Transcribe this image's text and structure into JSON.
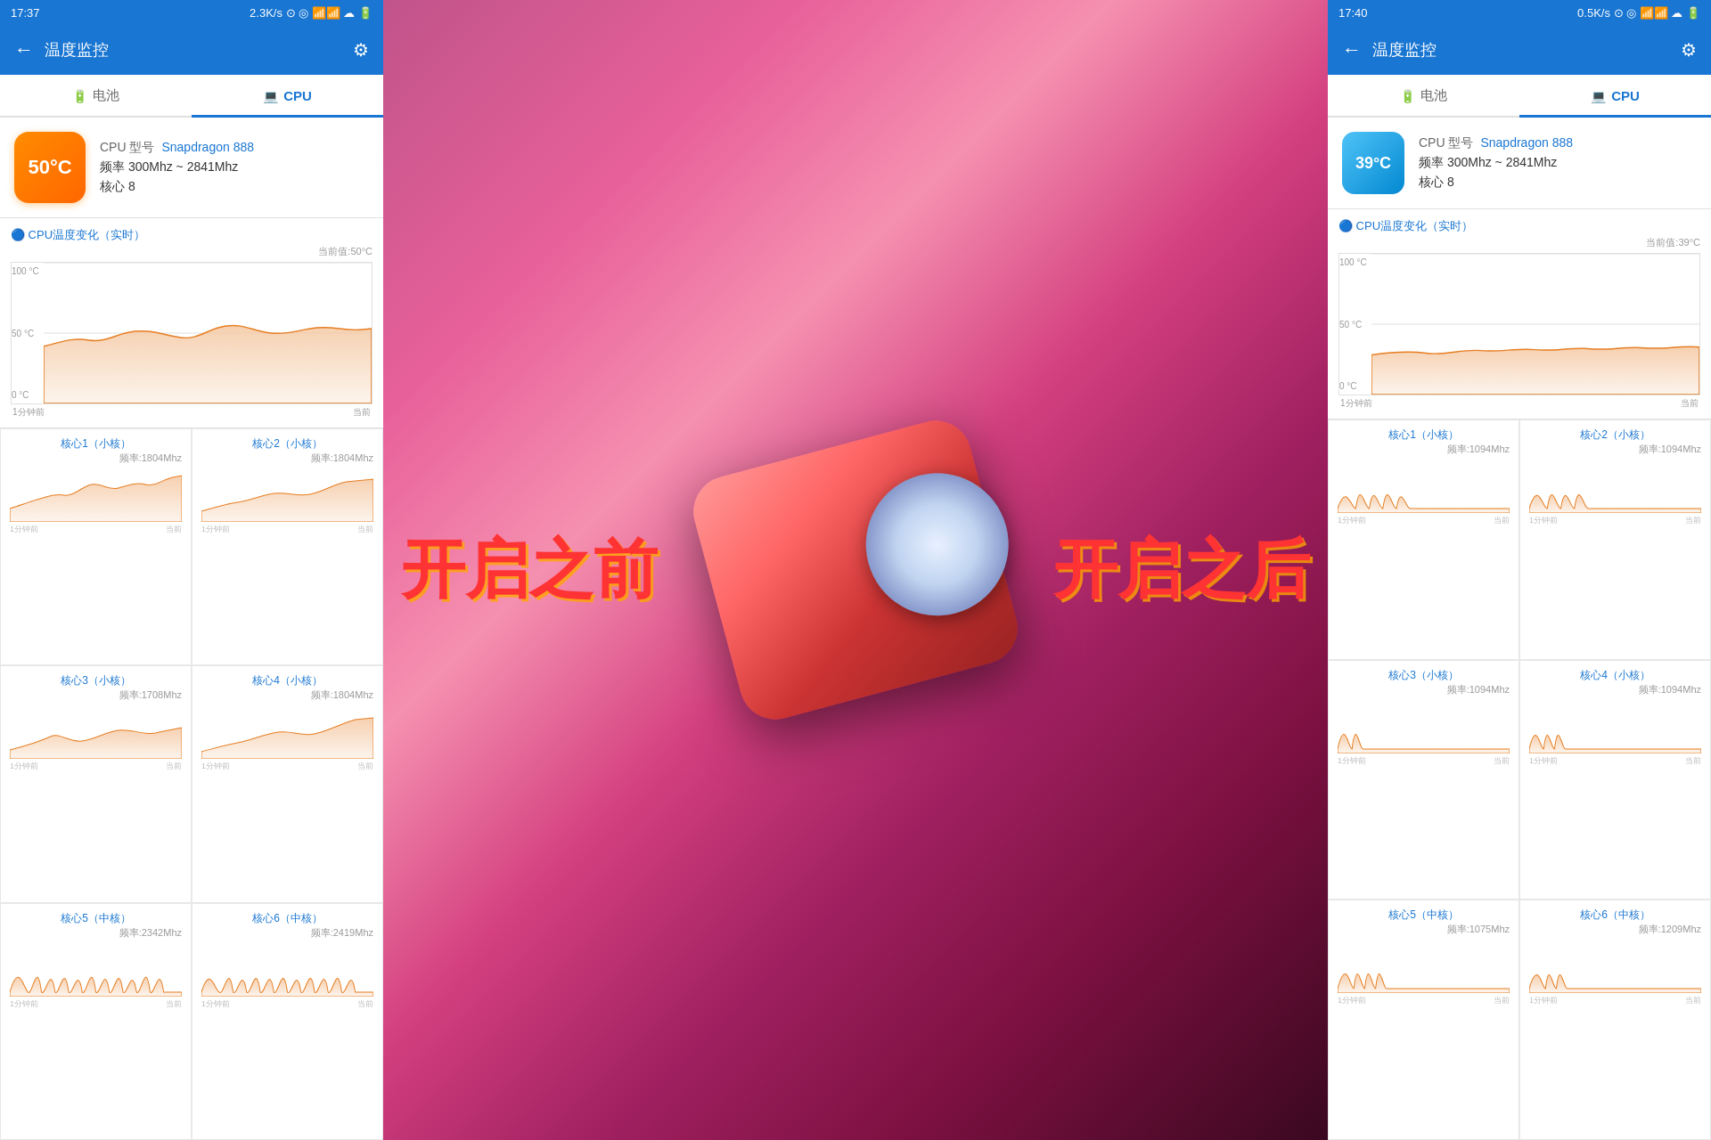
{
  "left_phone": {
    "status_bar": {
      "time": "17:37",
      "network": "2.3K/s",
      "icons": "⊙ ◎ 📶 📶 ☁ 🔋"
    },
    "app_bar": {
      "back_label": "←",
      "title": "温度监控",
      "settings_label": "⚙"
    },
    "tabs": [
      {
        "id": "battery",
        "label": "电池",
        "icon": "🔋",
        "active": false
      },
      {
        "id": "cpu",
        "label": "CPU",
        "icon": "💻",
        "active": true
      }
    ],
    "cpu_info": {
      "temperature": "50°C",
      "model_label": "CPU 型号",
      "model_value": "Snapdragon 888",
      "freq_label": "频率",
      "freq_value": "300Mhz ~ 2841Mhz",
      "core_label": "核心",
      "core_value": "8"
    },
    "cpu_chart": {
      "title": "🔵 CPU温度变化（实时）",
      "current_value_label": "当前值:50°C",
      "y_labels": [
        "100 °C",
        "50 °C",
        "0 °C"
      ],
      "x_labels": [
        "1分钟前",
        "当前"
      ]
    },
    "cores": [
      {
        "name": "核心1（小核）",
        "freq": "频率:1804Mhz",
        "x_labels": [
          "1分钟前",
          "当前"
        ]
      },
      {
        "name": "核心2（小核）",
        "freq": "频率:1804Mhz",
        "x_labels": [
          "1分钟前",
          "当前"
        ]
      },
      {
        "name": "核心3（小核）",
        "freq": "频率:1708Mhz",
        "x_labels": [
          "1分钟前",
          "当前"
        ]
      },
      {
        "name": "核心4（小核）",
        "freq": "频率:1804Mhz",
        "x_labels": [
          "1分钟前",
          "当前"
        ]
      },
      {
        "name": "核心5（中核）",
        "freq": "频率:2342Mhz",
        "x_labels": [
          "1分钟前",
          "当前"
        ]
      },
      {
        "name": "核心6（中核）",
        "freq": "频率:2419Mhz",
        "x_labels": [
          "1分钟前",
          "当前"
        ]
      }
    ],
    "overlay_text": "开启之前"
  },
  "right_phone": {
    "status_bar": {
      "time": "17:40",
      "network": "0.5K/s",
      "icons": "⊙ ◎ 📶 📶 ☁ 🔋"
    },
    "app_bar": {
      "back_label": "←",
      "title": "温度监控",
      "settings_label": "⚙"
    },
    "tabs": [
      {
        "id": "battery",
        "label": "电池",
        "icon": "🔋",
        "active": false
      },
      {
        "id": "cpu",
        "label": "CPU",
        "icon": "💻",
        "active": true
      }
    ],
    "cpu_info": {
      "temperature": "39°C",
      "model_label": "CPU 型号",
      "model_value": "Snapdragon 888",
      "freq_label": "频率",
      "freq_value": "300Mhz ~ 2841Mhz",
      "core_label": "核心",
      "core_value": "8"
    },
    "cpu_chart": {
      "title": "🔵 CPU温度变化（实时）",
      "current_value_label": "当前值:39°C",
      "y_labels": [
        "100 °C",
        "50 °C",
        "0 °C"
      ],
      "x_labels": [
        "1分钟前",
        "当前"
      ]
    },
    "cores": [
      {
        "name": "核心1（小核）",
        "freq": "频率:1094Mhz",
        "x_labels": [
          "1分钟前",
          "当前"
        ]
      },
      {
        "name": "核心2（小核）",
        "freq": "频率:1094Mhz",
        "x_labels": [
          "1分钟前",
          "当前"
        ]
      },
      {
        "name": "核心3（小核）",
        "freq": "频率:1094Mhz",
        "x_labels": [
          "1分钟前",
          "当前"
        ]
      },
      {
        "name": "核心4（小核）",
        "freq": "频率:1094Mhz",
        "x_labels": [
          "1分钟前",
          "当前"
        ]
      },
      {
        "name": "核心5（中核）",
        "freq": "频率:1075Mhz",
        "x_labels": [
          "1分钟前",
          "当前"
        ]
      },
      {
        "name": "核心6（中核）",
        "freq": "频率:1209Mhz",
        "x_labels": [
          "1分钟前",
          "当前"
        ]
      }
    ],
    "overlay_text": "开启之后"
  },
  "colors": {
    "primary": "#1976D2",
    "accent": "#FF6600",
    "chart_fill": "#F5CBA7",
    "chart_stroke": "#E67E22",
    "text_secondary": "#666666"
  }
}
